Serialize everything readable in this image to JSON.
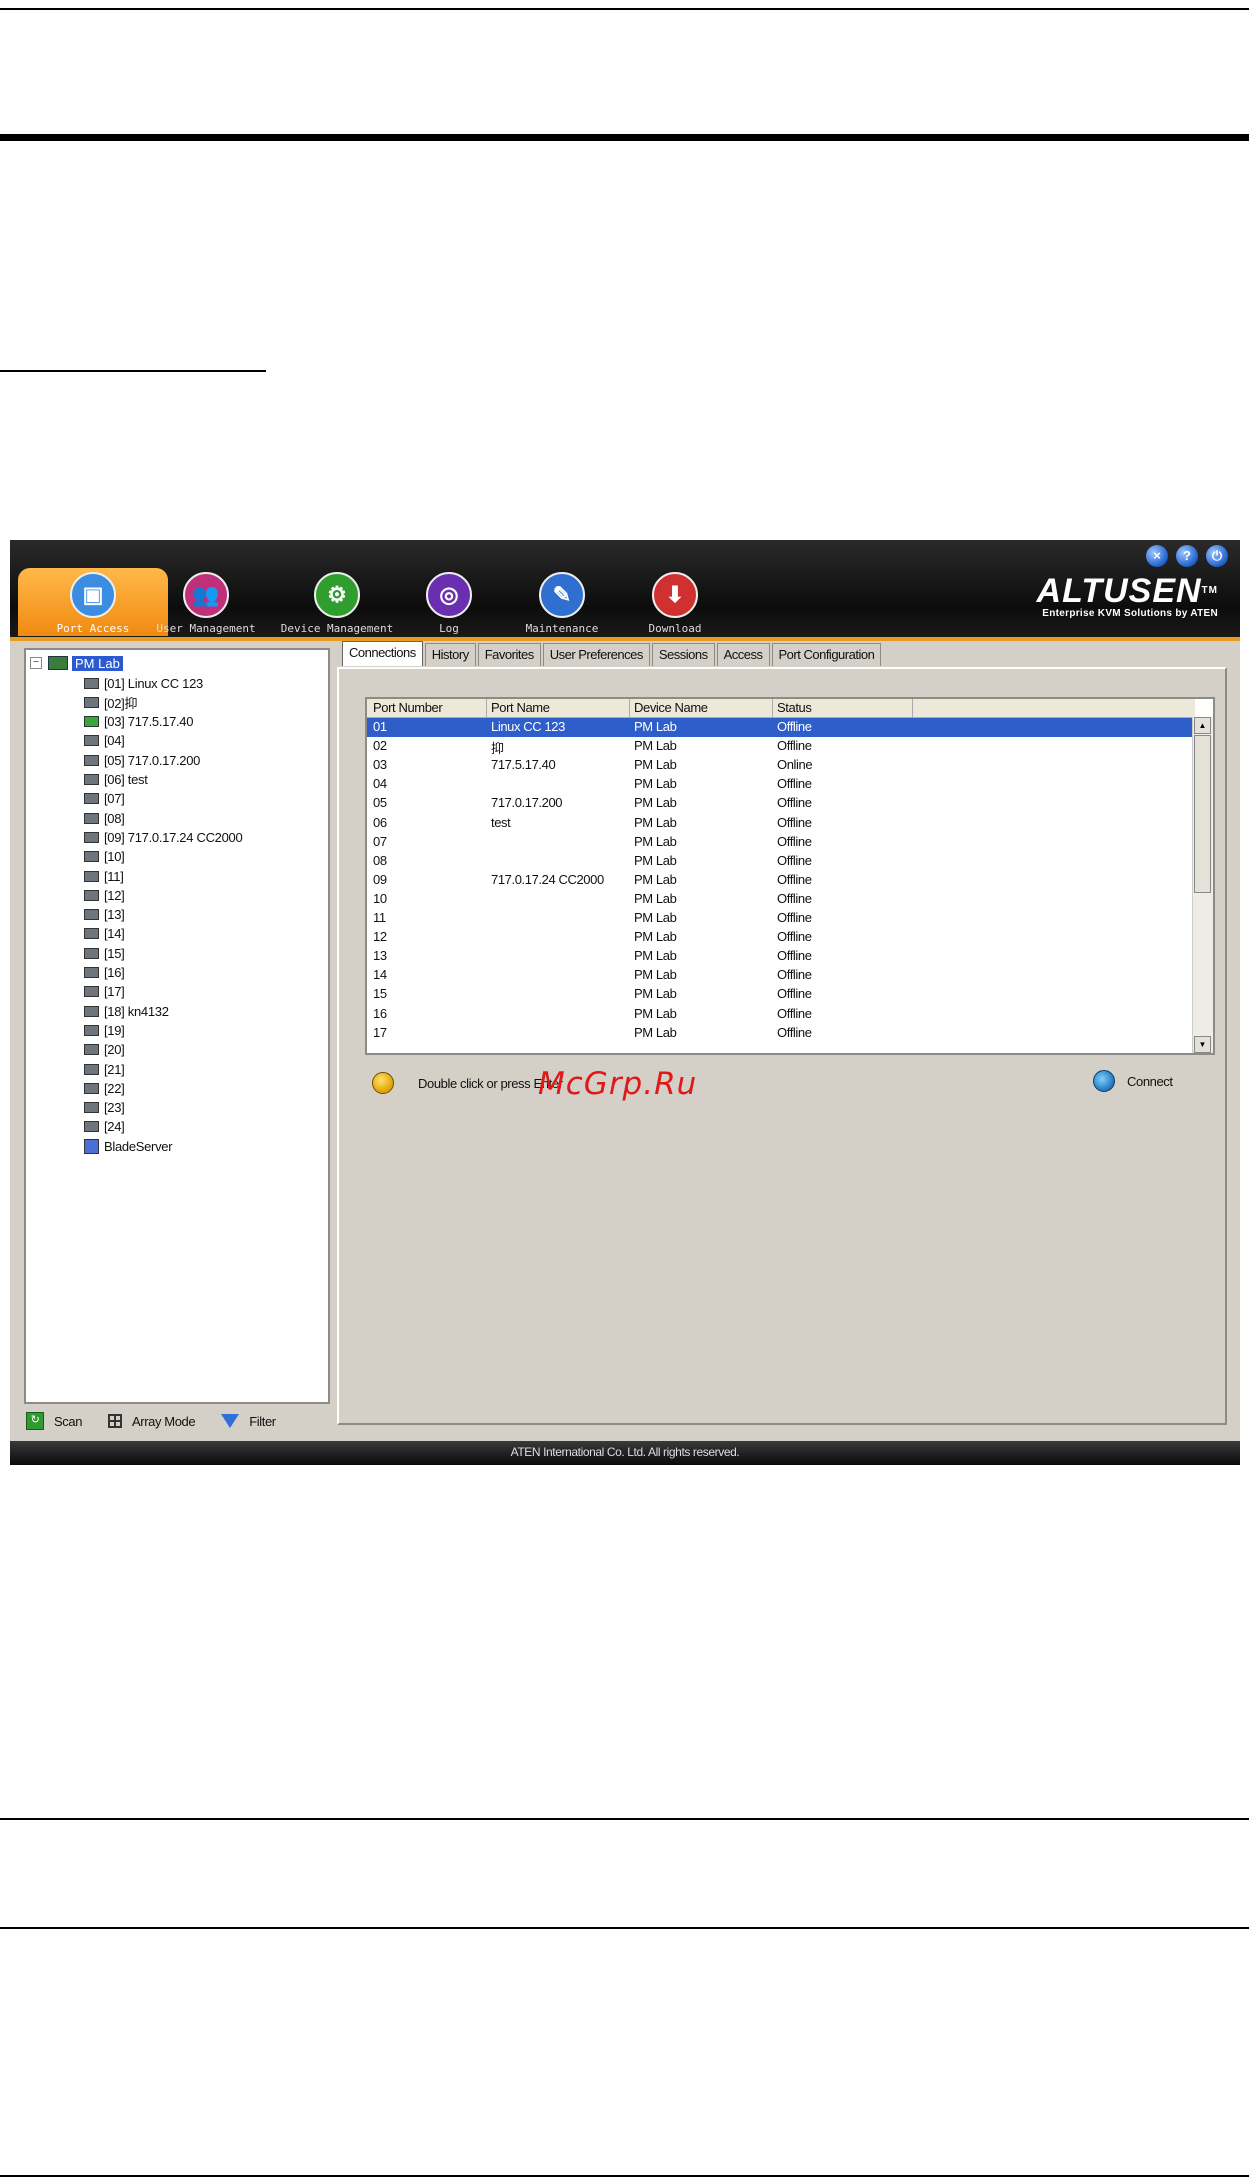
{
  "app": {
    "brand": "ALTUSEN",
    "brand_tm": "TM",
    "brand_tagline": "Enterprise KVM Solutions by ATEN",
    "window_controls": [
      "close-icon",
      "help-icon",
      "logout-icon"
    ],
    "accent_color": "#f08a10"
  },
  "nav": [
    {
      "label": "Port Access",
      "icon": "port-access-icon",
      "active": true,
      "color": "#3a8de0"
    },
    {
      "label": "User Management",
      "icon": "users-icon",
      "active": false,
      "color": "#c0307a"
    },
    {
      "label": "Device Management",
      "icon": "device-gear-icon",
      "active": false,
      "color": "#2f9e2f"
    },
    {
      "label": "Log",
      "icon": "log-icon",
      "active": false,
      "color": "#6a2fb0"
    },
    {
      "label": "Maintenance",
      "icon": "maintenance-icon",
      "active": false,
      "color": "#2f6fd0"
    },
    {
      "label": "Download",
      "icon": "download-icon",
      "active": false,
      "color": "#d03030"
    }
  ],
  "tree": {
    "root": "PM Lab",
    "items": [
      {
        "label": "[01] Linux CC 123",
        "status": "offline"
      },
      {
        "label": "[02]抑",
        "status": "offline"
      },
      {
        "label": "[03] 717.5.17.40",
        "status": "online"
      },
      {
        "label": "[04]",
        "status": "offline"
      },
      {
        "label": "[05] 717.0.17.200",
        "status": "offline"
      },
      {
        "label": "[06] test",
        "status": "offline"
      },
      {
        "label": "[07]",
        "status": "offline"
      },
      {
        "label": "[08]",
        "status": "offline"
      },
      {
        "label": "[09] 717.0.17.24 CC2000",
        "status": "offline"
      },
      {
        "label": "[10]",
        "status": "offline"
      },
      {
        "label": "[11]",
        "status": "offline"
      },
      {
        "label": "[12]",
        "status": "offline"
      },
      {
        "label": "[13]",
        "status": "offline"
      },
      {
        "label": "[14]",
        "status": "offline"
      },
      {
        "label": "[15]",
        "status": "offline"
      },
      {
        "label": "[16]",
        "status": "offline"
      },
      {
        "label": "[17]",
        "status": "offline"
      },
      {
        "label": "[18] kn4132",
        "status": "offline"
      },
      {
        "label": "[19]",
        "status": "offline"
      },
      {
        "label": "[20]",
        "status": "offline"
      },
      {
        "label": "[21]",
        "status": "offline"
      },
      {
        "label": "[22]",
        "status": "offline"
      },
      {
        "label": "[23]",
        "status": "offline"
      },
      {
        "label": "[24]",
        "status": "offline"
      },
      {
        "label": "BladeServer",
        "status": "blade"
      }
    ],
    "footer": {
      "scan": "Scan",
      "array_mode": "Array Mode",
      "filter": "Filter"
    }
  },
  "tabs": [
    "Connections",
    "History",
    "Favorites",
    "User Preferences",
    "Sessions",
    "Access",
    "Port Configuration"
  ],
  "active_tab": "Connections",
  "table": {
    "columns": [
      "Port Number",
      "Port Name",
      "Device Name",
      "Status"
    ],
    "selected_index": 0,
    "rows": [
      [
        "01",
        "Linux CC 123",
        "PM Lab",
        "Offline"
      ],
      [
        "02",
        "抑",
        "PM Lab",
        "Offline"
      ],
      [
        "03",
        "717.5.17.40",
        "PM Lab",
        "Online"
      ],
      [
        "04",
        "",
        "PM Lab",
        "Offline"
      ],
      [
        "05",
        "717.0.17.200",
        "PM Lab",
        "Offline"
      ],
      [
        "06",
        "test",
        "PM Lab",
        "Offline"
      ],
      [
        "07",
        "",
        "PM Lab",
        "Offline"
      ],
      [
        "08",
        "",
        "PM Lab",
        "Offline"
      ],
      [
        "09",
        "717.0.17.24 CC2000",
        "PM Lab",
        "Offline"
      ],
      [
        "10",
        "",
        "PM Lab",
        "Offline"
      ],
      [
        "11",
        "",
        "PM Lab",
        "Offline"
      ],
      [
        "12",
        "",
        "PM Lab",
        "Offline"
      ],
      [
        "13",
        "",
        "PM Lab",
        "Offline"
      ],
      [
        "14",
        "",
        "PM Lab",
        "Offline"
      ],
      [
        "15",
        "",
        "PM Lab",
        "Offline"
      ],
      [
        "16",
        "",
        "PM Lab",
        "Offline"
      ],
      [
        "17",
        "",
        "PM Lab",
        "Offline"
      ]
    ]
  },
  "hint_text": "Double click or press Enter",
  "connect_label": "Connect",
  "watermark": "McGrp.Ru",
  "footer_text": "ATEN International Co. Ltd. All rights reserved."
}
